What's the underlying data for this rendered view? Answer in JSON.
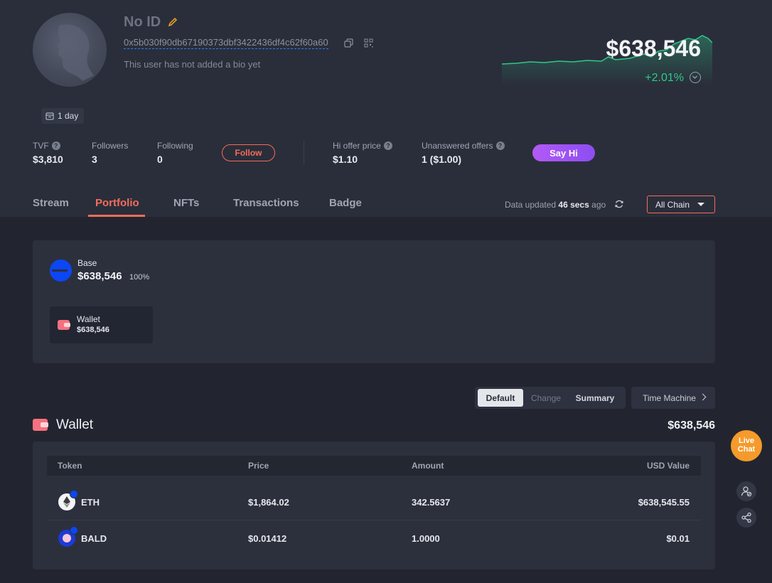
{
  "profile": {
    "name": "No ID",
    "address": "0x5b030f90db67190373dbf3422436df4c62f60a60",
    "bio": "This user has not added a bio yet",
    "age": "1 day",
    "net_worth": "$638,546",
    "change": "+2.01%"
  },
  "stats": {
    "tvf_label": "TVF",
    "tvf_value": "$3,810",
    "followers_label": "Followers",
    "followers_value": "3",
    "following_label": "Following",
    "following_value": "0",
    "follow_button": "Follow",
    "hi_label": "Hi offer price",
    "hi_value": "$1.10",
    "unanswered_label": "Unanswered offers",
    "unanswered_value": "1 ($1.00)",
    "say_hi_button": "Say Hi"
  },
  "tabs": [
    {
      "label": "Stream"
    },
    {
      "label": "Portfolio",
      "active": true
    },
    {
      "label": "NFTs"
    },
    {
      "label": "Transactions"
    },
    {
      "label": "Badge"
    }
  ],
  "updated": {
    "prefix": "Data updated",
    "time": "46 secs",
    "suffix": "ago"
  },
  "chain_filter": "All Chain",
  "summary": {
    "chain_name": "Base",
    "chain_value": "$638,546",
    "chain_pct": "100%",
    "wallet_name": "Wallet",
    "wallet_value": "$638,546"
  },
  "view_modes": {
    "default": "Default",
    "change": "Change",
    "summary": "Summary",
    "time_machine": "Time Machine"
  },
  "wallet_section": {
    "title": "Wallet",
    "total": "$638,546"
  },
  "table": {
    "headers": {
      "token": "Token",
      "price": "Price",
      "amount": "Amount",
      "usd": "USD Value"
    },
    "rows": [
      {
        "token": "ETH",
        "price": "$1,864.02",
        "amount": "342.5637",
        "usd": "$638,545.55"
      },
      {
        "token": "BALD",
        "price": "$0.01412",
        "amount": "1.0000",
        "usd": "$0.01"
      }
    ]
  },
  "live_chat": {
    "line1": "Live",
    "line2": "Chat"
  },
  "colors": {
    "accent": "#f26d5b",
    "positive": "#2fc98a",
    "say_hi": "#b25af7",
    "base_chain": "#0c46f5",
    "live_chat": "#f59a2b"
  },
  "icons": [
    "edit-icon",
    "copy-icon",
    "qr-code-icon",
    "calendar-icon",
    "help-icon",
    "refresh-icon",
    "caret-down-icon",
    "wallet-icon",
    "chevron-right-icon",
    "user-check-icon",
    "share-icon"
  ]
}
